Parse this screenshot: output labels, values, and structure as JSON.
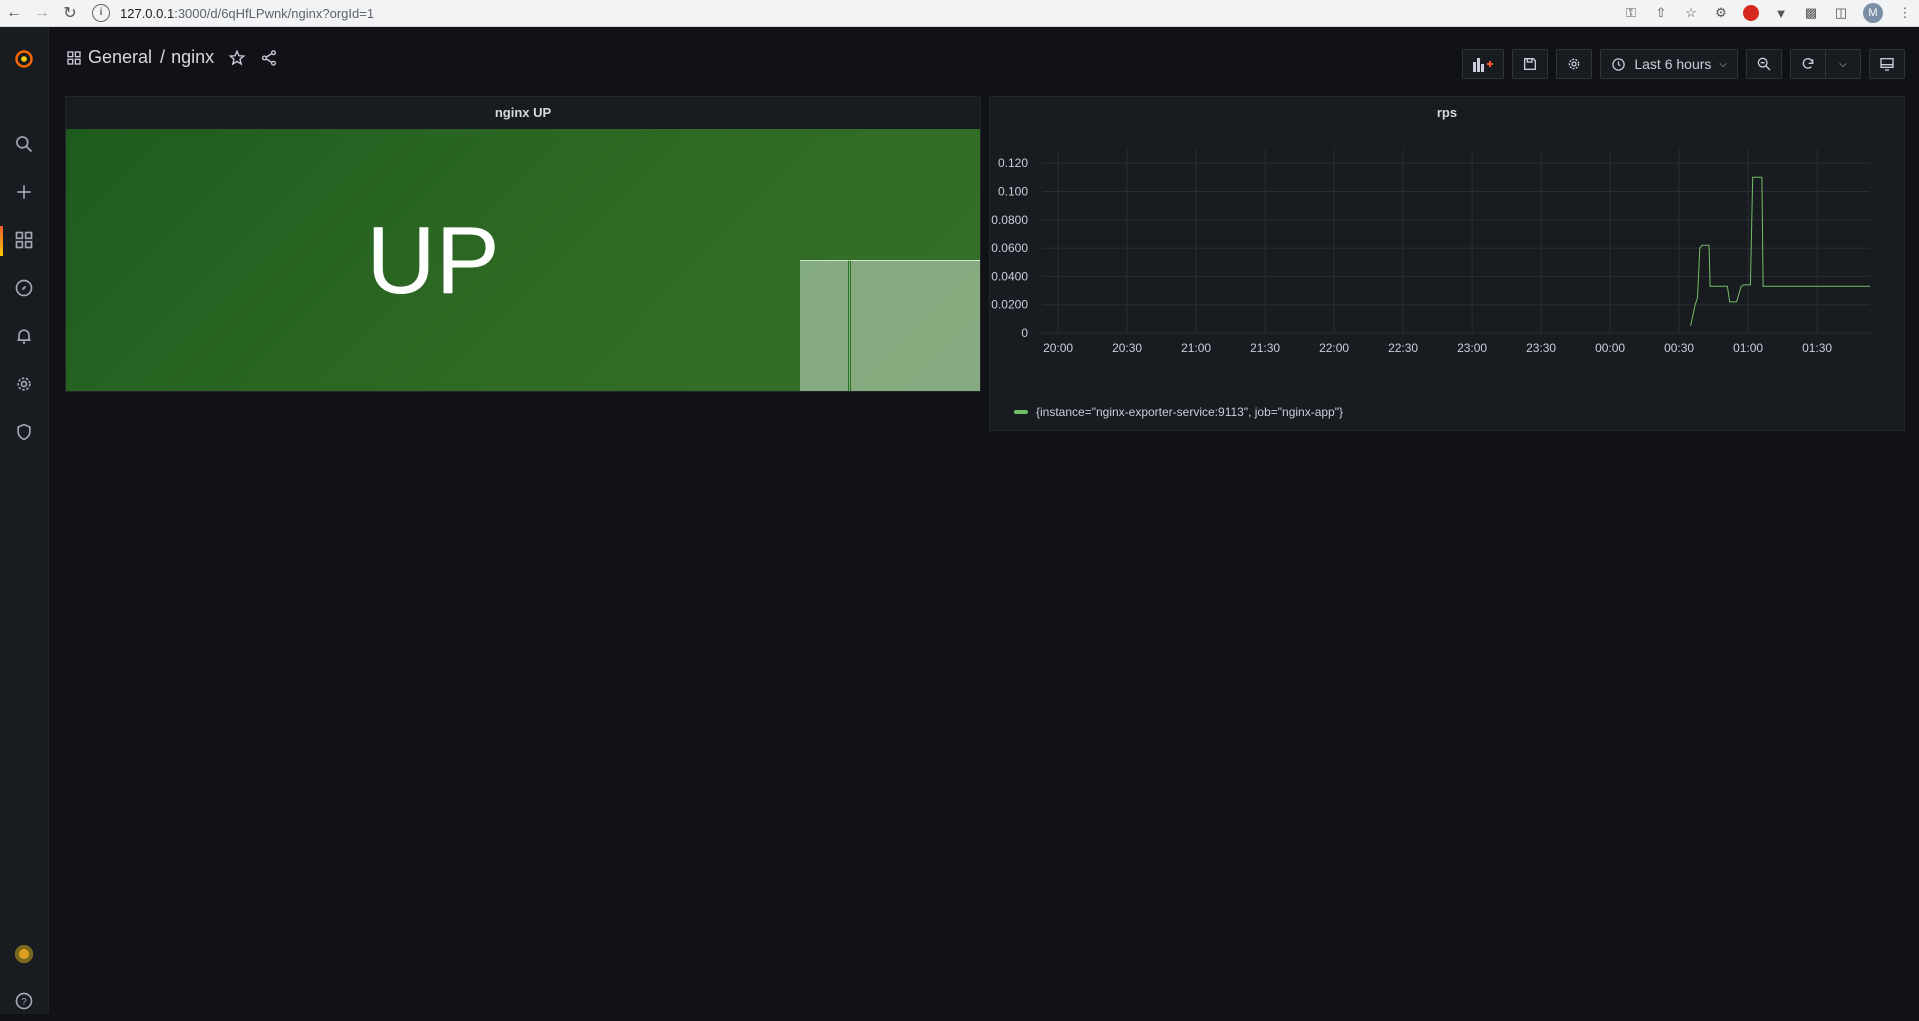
{
  "browser": {
    "url_host": "127.0.0.1",
    "url_path": ":3000/d/6qHfLPwnk/nginx?orgId=1",
    "profile_initial": "M"
  },
  "breadcrumb": {
    "folder": "General",
    "separator": "/",
    "dashboard": "nginx"
  },
  "toolbar": {
    "time_range": "Last 6 hours"
  },
  "panels": {
    "stat": {
      "title": "nginx UP",
      "value": "UP",
      "color": "#37872d"
    },
    "graph": {
      "title": "rps",
      "legend": "{instance=\"nginx-exporter-service:9113\", job=\"nginx-app\"}",
      "series_color": "#73bf69"
    }
  },
  "chart_data": {
    "type": "line",
    "title": "rps",
    "xlabel": "",
    "ylabel": "",
    "x_ticks": [
      "20:00",
      "20:30",
      "21:00",
      "21:30",
      "22:00",
      "22:30",
      "23:00",
      "23:30",
      "00:00",
      "00:30",
      "01:00",
      "01:30"
    ],
    "y_ticks": [
      "0",
      "0.0200",
      "0.0400",
      "0.0600",
      "0.0800",
      "0.100",
      "0.120"
    ],
    "ylim": [
      0,
      0.13
    ],
    "x_range_minutes_from_2000": [
      -7,
      353
    ],
    "grid": true,
    "legend_position": "bottom-left",
    "series": [
      {
        "name": "{instance=\"nginx-exporter-service:9113\", job=\"nginx-app\"}",
        "x_minutes_from_2000": [
          275,
          277,
          278,
          279,
          280,
          283,
          283.5,
          286,
          291,
          292,
          295,
          297,
          298,
          301,
          302,
          303,
          306,
          306.5,
          338,
          340,
          345,
          353
        ],
        "values": [
          0.005,
          0.02,
          0.025,
          0.06,
          0.062,
          0.062,
          0.033,
          0.033,
          0.033,
          0.022,
          0.022,
          0.033,
          0.034,
          0.034,
          0.11,
          0.11,
          0.11,
          0.033,
          0.033,
          0.033,
          0.033,
          0.033
        ]
      }
    ]
  }
}
